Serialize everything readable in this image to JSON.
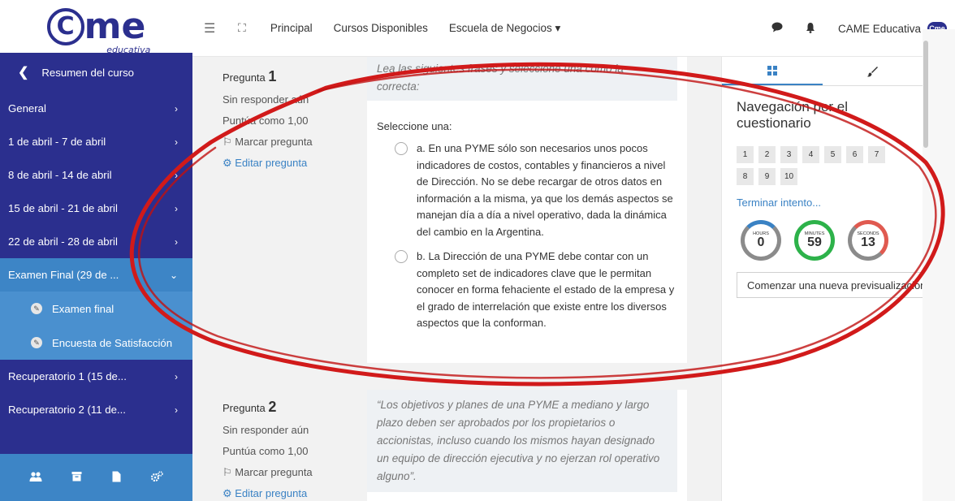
{
  "brand": {
    "logo_text": "me",
    "logo_sub": "educativa"
  },
  "header": {
    "nav": [
      "Principal",
      "Cursos Disponibles",
      "Escuela de Negocios ▾"
    ],
    "user": "CAME Educativa",
    "mini_logo": "Cme"
  },
  "sidebar": {
    "back_label": "Resumen del curso",
    "items": [
      {
        "label": "General"
      },
      {
        "label": "1 de abril - 7 de abril"
      },
      {
        "label": "8 de abril - 14 de abril"
      },
      {
        "label": "15 de abril - 21 de abril"
      },
      {
        "label": "22 de abril - 28 de abril"
      },
      {
        "label": "Examen Final (29 de ..."
      }
    ],
    "sub_items": [
      {
        "label": "Examen final"
      },
      {
        "label": "Encuesta de Satisfacción"
      }
    ],
    "items_after": [
      {
        "label": "Recuperatorio 1 (15 de..."
      },
      {
        "label": "Recuperatorio 2 (11 de..."
      }
    ]
  },
  "question1": {
    "label": "Pregunta",
    "number": "1",
    "status": "Sin responder aún",
    "score": "Puntúa como 1,00",
    "flag": "Marcar pregunta",
    "edit": "Editar pregunta",
    "text": "Lea las siguientes frases y seleccione una como la correcta:",
    "prompt": "Seleccione una:",
    "options": [
      "a. En una PYME sólo son necesarios unos pocos indicadores de costos, contables y financieros a nivel de Dirección. No se debe recargar de otros datos en información a la misma, ya que los demás aspectos se manejan día a día a nivel operativo, dada la dinámica del cambio en la Argentina.",
      "b. La Dirección de una PYME debe contar con un completo set de indicadores clave que le permitan conocer en forma fehaciente el estado de la empresa y el grado de interrelación que existe entre los diversos aspectos que la conforman."
    ]
  },
  "question2": {
    "label": "Pregunta",
    "number": "2",
    "status": "Sin responder aún",
    "score": "Puntúa como 1,00",
    "flag": "Marcar pregunta",
    "edit": "Editar pregunta",
    "text": "“Los objetivos y planes de una PYME a mediano y largo plazo deben ser aprobados por los propietarios o accionistas, incluso cuando los mismos hayan designado un equipo de dirección ejecutiva y no ejerzan rol operativo alguno”."
  },
  "quiz_nav": {
    "title": "Navegación por el cuestionario",
    "buttons": [
      "1",
      "2",
      "3",
      "4",
      "5",
      "6",
      "7",
      "8",
      "9",
      "10"
    ],
    "finish": "Terminar intento...",
    "timer": {
      "hours_label": "Hours",
      "hours": "0",
      "minutes_label": "Minutes",
      "minutes": "59",
      "seconds_label": "Seconds",
      "seconds": "13"
    },
    "preview_button": "Comenzar una nueva previsualización"
  }
}
